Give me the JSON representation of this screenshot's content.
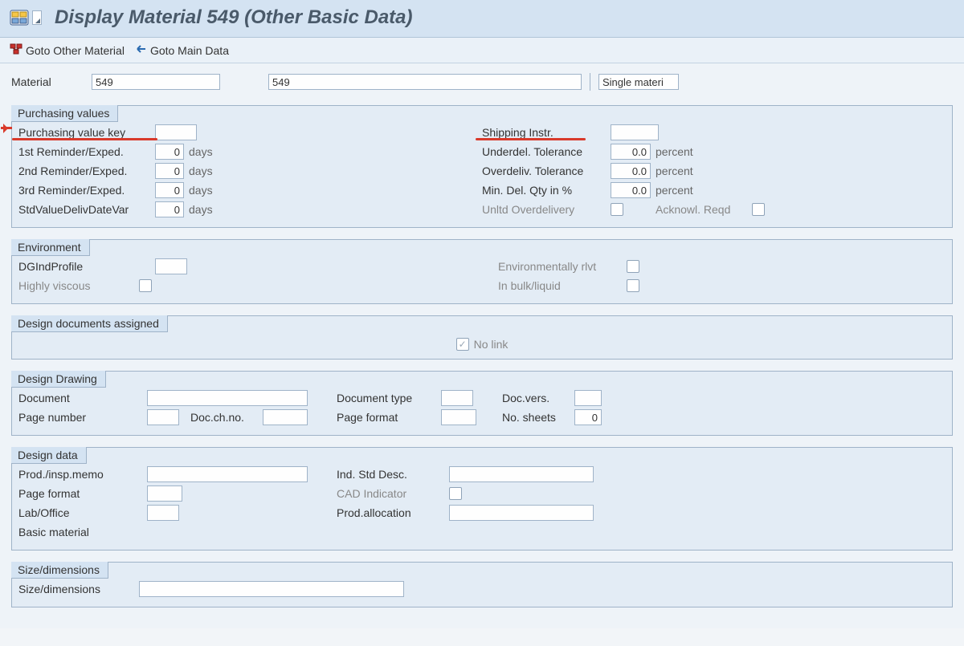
{
  "title": "Display Material 549 (Other Basic Data)",
  "toolbar": {
    "goto_other": "Goto Other Material",
    "goto_main": "Goto Main Data"
  },
  "header": {
    "material_label": "Material",
    "material_value": "549",
    "description_value": "549",
    "type_value": "Single materi"
  },
  "groups": {
    "purch": {
      "title": "Purchasing values",
      "left": {
        "pvkey": "Purchasing value key",
        "r1": {
          "label": "1st Reminder/Exped.",
          "value": "0",
          "unit": "days"
        },
        "r2": {
          "label": "2nd Reminder/Exped.",
          "value": "0",
          "unit": "days"
        },
        "r3": {
          "label": "3rd Reminder/Exped.",
          "value": "0",
          "unit": "days"
        },
        "r4": {
          "label": "StdValueDelivDateVar",
          "value": "0",
          "unit": "days"
        }
      },
      "right": {
        "ship": "Shipping Instr.",
        "under": {
          "label": "Underdel. Tolerance",
          "value": "0.0",
          "unit": "percent"
        },
        "over": {
          "label": "Overdeliv. Tolerance",
          "value": "0.0",
          "unit": "percent"
        },
        "minqty": {
          "label": "Min. Del. Qty in %",
          "value": "0.0",
          "unit": "percent"
        },
        "unltd": "Unltd Overdelivery",
        "ack": "Acknowl. Reqd"
      }
    },
    "env": {
      "title": "Environment",
      "dgind": "DGIndProfile",
      "viscous": "Highly viscous",
      "envrel": "Environmentally rlvt",
      "bulk": "In bulk/liquid"
    },
    "designdocs": {
      "title": "Design documents assigned",
      "nolink": "No link"
    },
    "drawing": {
      "title": "Design Drawing",
      "document": "Document",
      "doctype": "Document type",
      "docvers": "Doc.vers.",
      "page": "Page number",
      "chno": "Doc.ch.no.",
      "pagefmt": "Page format",
      "nosheets": "No. sheets",
      "nosheets_val": "0"
    },
    "designdata": {
      "title": "Design data",
      "prodinsp": "Prod./insp.memo",
      "indstd": "Ind. Std Desc.",
      "pagefmt": "Page format",
      "cad": "CAD Indicator",
      "laboffice": "Lab/Office",
      "prodalloc": "Prod.allocation",
      "basicmat": "Basic material"
    },
    "size": {
      "title": "Size/dimensions",
      "label": "Size/dimensions"
    }
  }
}
